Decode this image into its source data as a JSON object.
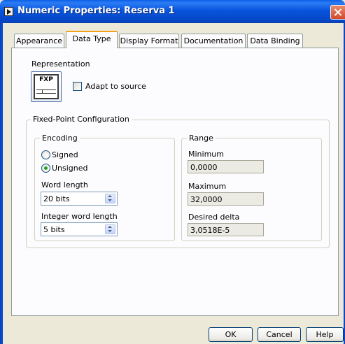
{
  "window": {
    "title": "Numeric Properties: Reserva 1"
  },
  "tabs": [
    {
      "label": "Appearance",
      "active": false
    },
    {
      "label": "Data Type",
      "active": true
    },
    {
      "label": "Display Format",
      "active": false
    },
    {
      "label": "Documentation",
      "active": false
    },
    {
      "label": "Data Binding",
      "active": false
    }
  ],
  "representation": {
    "label": "Representation",
    "icon_text": "FXP",
    "icon": "fixed-point-icon",
    "adapt_label": "Adapt to source",
    "adapt_checked": false
  },
  "fixed_point": {
    "title": "Fixed-Point Configuration",
    "encoding": {
      "title": "Encoding",
      "signed_label": "Signed",
      "unsigned_label": "Unsigned",
      "selected": "Unsigned",
      "word_length_label": "Word length",
      "word_length_value": "20 bits",
      "integer_word_length_label": "Integer word length",
      "integer_word_length_value": "5 bits"
    },
    "range": {
      "title": "Range",
      "minimum_label": "Minimum",
      "minimum_value": "0,0000",
      "maximum_label": "Maximum",
      "maximum_value": "32,0000",
      "delta_label": "Desired delta",
      "delta_value": "3,0518E-5"
    }
  },
  "buttons": {
    "ok": "OK",
    "cancel": "Cancel",
    "help": "Help"
  },
  "colors": {
    "title_bar": "#0a56de",
    "active_tab_accent": "#f6a11a",
    "close_button": "#d3492a",
    "dialog_bg": "#ece9d8"
  }
}
